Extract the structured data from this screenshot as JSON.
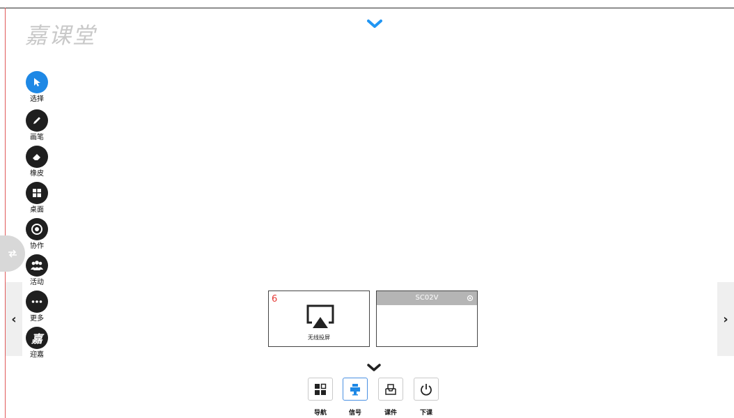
{
  "logo": {
    "text": "嘉课堂"
  },
  "toolbar": {
    "items": [
      {
        "label": "选择",
        "icon": "cursor-icon"
      },
      {
        "label": "画笔",
        "icon": "pen-icon"
      },
      {
        "label": "橡皮",
        "icon": "eraser-icon"
      },
      {
        "label": "桌面",
        "icon": "windows-icon"
      },
      {
        "label": "协作",
        "icon": "collaborate-icon"
      },
      {
        "label": "活动",
        "icon": "people-icon"
      },
      {
        "label": "更多",
        "icon": "more-icon"
      },
      {
        "label": "迎嘉",
        "icon": "jia-logo-icon"
      }
    ],
    "jia_glyph": "嘉"
  },
  "nav": {
    "left": "‹",
    "right": "›"
  },
  "cards": {
    "cast": {
      "number": "6",
      "label": "无线投屏"
    },
    "signal": {
      "title": "SC02V"
    }
  },
  "bottom_bar": {
    "items": [
      {
        "label": "导航",
        "icon": "grid-icon"
      },
      {
        "label": "信号",
        "icon": "signal-icon",
        "active": true
      },
      {
        "label": "课件",
        "icon": "courseware-icon"
      },
      {
        "label": "下课",
        "icon": "power-icon"
      }
    ]
  },
  "colors": {
    "accent": "#1e88e5",
    "number": "#e53935",
    "card_header": "#b5b5b5"
  }
}
